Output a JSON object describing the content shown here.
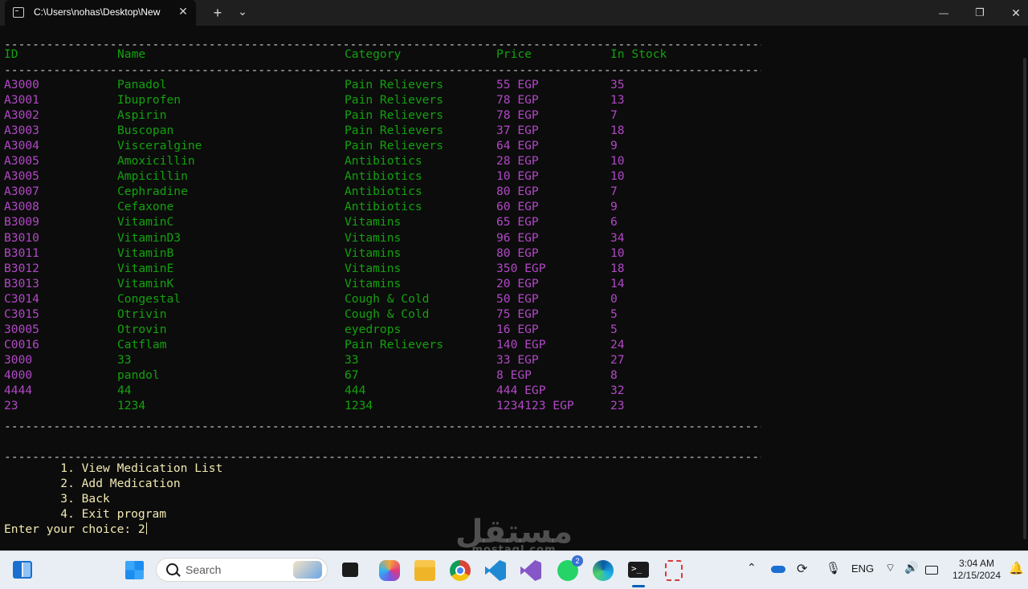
{
  "window": {
    "tab_title": "C:\\Users\\nohas\\Desktop\\New",
    "tab_close": "✕",
    "new_tab": "+",
    "tab_dropdown": "⌄",
    "minimize": "—",
    "maximize": "❐",
    "close": "✕"
  },
  "terminal": {
    "separator": "--------------------------------------------------------------------------------------------------------------------------------------------------------",
    "headers": [
      "ID",
      "Name",
      "Category",
      "Price",
      "In Stock"
    ],
    "rows": [
      [
        "A3000",
        "Panadol",
        "Pain Relievers",
        "55 EGP",
        "35"
      ],
      [
        "A3001",
        "Ibuprofen",
        "Pain Relievers",
        "78 EGP",
        "13"
      ],
      [
        "A3002",
        "Aspirin",
        "Pain Relievers",
        "78 EGP",
        "7"
      ],
      [
        "A3003",
        "Buscopan",
        "Pain Relievers",
        "37 EGP",
        "18"
      ],
      [
        "A3004",
        "Visceralgine",
        "Pain Relievers",
        "64 EGP",
        "9"
      ],
      [
        "A3005",
        "Amoxicillin",
        "Antibiotics",
        "28 EGP",
        "10"
      ],
      [
        "A3005",
        "Ampicillin",
        "Antibiotics",
        "10 EGP",
        "10"
      ],
      [
        "A3007",
        "Cephradine",
        "Antibiotics",
        "80 EGP",
        "7"
      ],
      [
        "A3008",
        "Cefaxone",
        "Antibiotics",
        "60 EGP",
        "9"
      ],
      [
        "B3009",
        "VitaminC",
        "Vitamins",
        "65 EGP",
        "6"
      ],
      [
        "B3010",
        "VitaminD3",
        "Vitamins",
        "96 EGP",
        "34"
      ],
      [
        "B3011",
        "VitaminB",
        "Vitamins",
        "80 EGP",
        "10"
      ],
      [
        "B3012",
        "VitaminE",
        "Vitamins",
        "350 EGP",
        "18"
      ],
      [
        "B3013",
        "VitaminK",
        "Vitamins",
        "20 EGP",
        "14"
      ],
      [
        "C3014",
        "Congestal",
        "Cough & Cold",
        "50 EGP",
        "0"
      ],
      [
        "C3015",
        "Otrivin",
        "Cough & Cold",
        "75 EGP",
        "5"
      ],
      [
        "30005",
        "Otrovin",
        "eyedrops",
        "16 EGP",
        "5"
      ],
      [
        "C0016",
        "Catflam",
        "Pain Relievers",
        "140 EGP",
        "24"
      ],
      [
        "3000",
        "33",
        "33",
        "33 EGP",
        "27"
      ],
      [
        "4000",
        "pandol",
        "67",
        "8 EGP",
        "8"
      ],
      [
        "4444",
        "44",
        "444",
        "444 EGP",
        "32"
      ],
      [
        "23",
        "1234",
        "1234",
        "1234123 EGP",
        "23"
      ]
    ],
    "menu": [
      "        1. View Medication List",
      "        2. Add Medication",
      "        3. Back",
      "        4. Exit program"
    ],
    "prompt": "Enter your choice: 2"
  },
  "watermark": {
    "text": "مستقل",
    "sub": "mostaql.com"
  },
  "taskbar": {
    "search_placeholder": "Search",
    "language": "ENG",
    "time": "3:04 AM",
    "date": "12/15/2024",
    "whatsapp_badge": "2",
    "icons": [
      "widgets-icon",
      "start-icon",
      "search-icon",
      "task-view-icon",
      "copilot-icon",
      "file-explorer-icon",
      "chrome-icon",
      "vscode-icon",
      "visual-studio-icon",
      "whatsapp-icon",
      "edge-icon",
      "terminal-icon",
      "snipping-tool-icon"
    ]
  }
}
